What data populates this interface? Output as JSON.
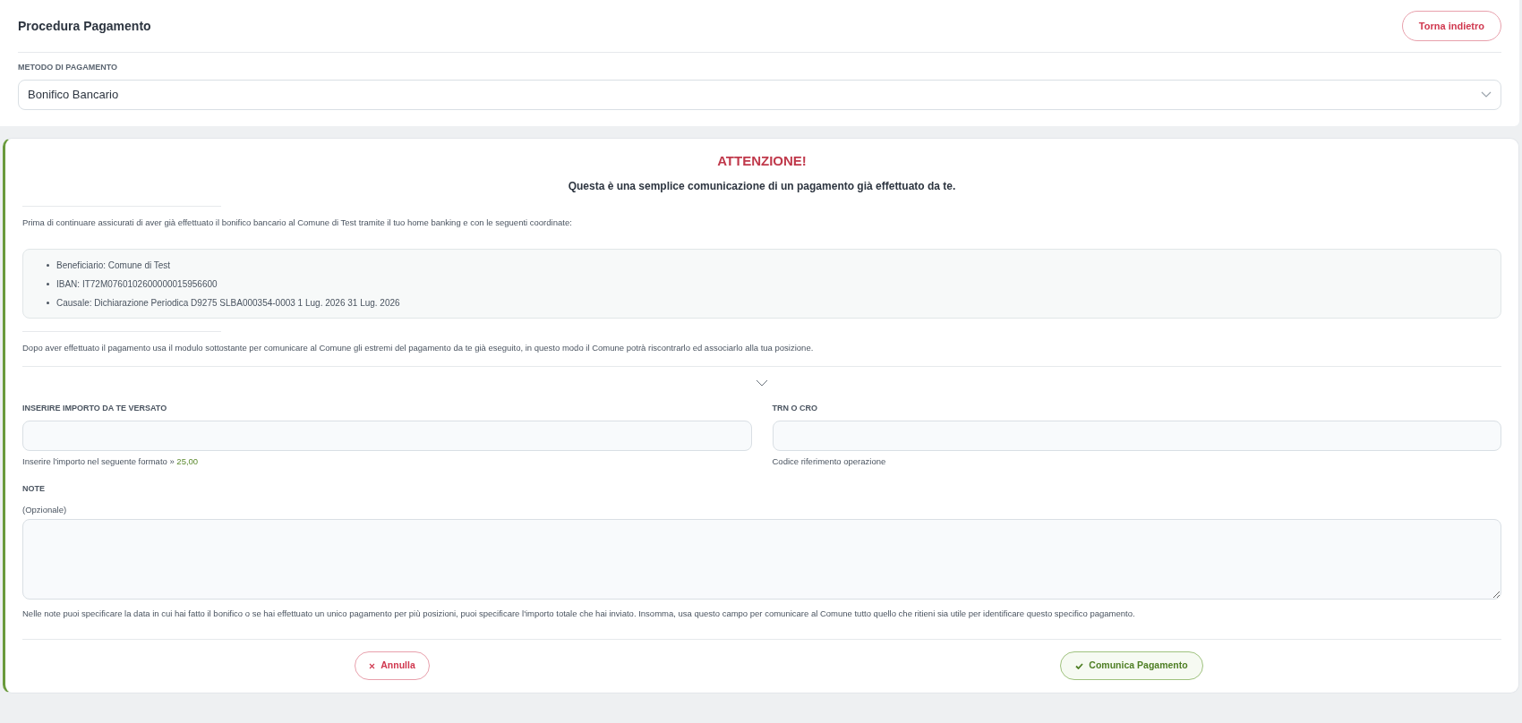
{
  "header": {
    "title": "Procedura Pagamento",
    "back_button": "Torna indietro"
  },
  "payment_method": {
    "label": "METODO DI PAGAMENTO",
    "value": "Bonifico Bancario"
  },
  "notice": {
    "title": "ATTENZIONE!",
    "subtitle": "Questa è una semplice comunicazione di un pagamento già effettuato da te.",
    "intro": "Prima di continuare assicurati di aver già effettuato il bonifico bancario al Comune di Test tramite il tuo home banking e con le seguenti coordinate:",
    "details": [
      "Beneficiario: Comune di Test",
      "IBAN: IT72M0760102600000015956600",
      "Causale: Dichiarazione Periodica D9275 SLBA000354-0003 1 Lug. 2026 31 Lug. 2026"
    ],
    "outro": "Dopo aver effettuato il pagamento usa il modulo sottostante per comunicare al Comune gli estremi del pagamento da te già eseguito, in questo modo il Comune potrà riscontrarlo ed associarlo alla tua posizione."
  },
  "form": {
    "amount": {
      "label": "INSERIRE IMPORTO DA TE VERSATO",
      "hint": "Inserire l'importo nel seguente formato »",
      "example": "25,00"
    },
    "trn": {
      "label": "TRN O CRO",
      "hint": "Codice riferimento operazione"
    },
    "note": {
      "label": "NOTE",
      "sublabel": "(Opzionale)",
      "hint": "Nelle note puoi specificare la data in cui hai fatto il bonifico o se hai effettuato un unico pagamento per più posizioni, puoi specificare l'importo totale che hai inviato. Insomma, usa questo campo per comunicare al Comune tutto quello che ritieni sia utile per identificare questo specifico pagamento."
    }
  },
  "buttons": {
    "cancel": "Annulla",
    "submit": "Comunica Pagamento"
  }
}
